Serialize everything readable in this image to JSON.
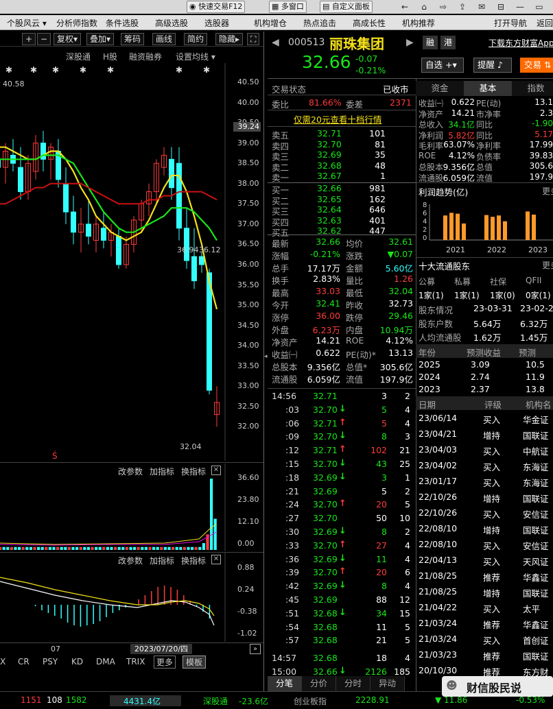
{
  "topbar": {
    "quick_trade": "快速交易F12",
    "multi_window": "多窗口",
    "custom_panel": "自定义面板"
  },
  "menu": [
    "个股风云",
    "分析师指数",
    "条件选股",
    "高级选股",
    "选股器",
    "机构增仓",
    "热点追击",
    "高成长性",
    "机构推荐",
    "打开导航",
    "返回"
  ],
  "chart_toolbar": {
    "restore": "复权",
    "overlay": "叠加",
    "chips": "筹码",
    "draw": "画线",
    "simple": "简约",
    "hide": "隐藏"
  },
  "chart_tabs": [
    "深股通",
    "H股",
    "融资融券",
    "设置均线"
  ],
  "price_axis": [
    "40.50",
    "40.00",
    "39.50",
    "39.00",
    "38.50",
    "38.00",
    "37.50",
    "37.00",
    "36.50",
    "36.00",
    "35.50",
    "35.00",
    "34.50",
    "34.00",
    "33.50",
    "33.00",
    "32.50",
    "32.00"
  ],
  "price_labels": {
    "high": "40.58",
    "current_tag": "39.24",
    "low": "32.04",
    "mid": "36.94",
    "mid2": "36.12"
  },
  "vol_panel": {
    "btns": [
      "改参数",
      "加指标",
      "换指标"
    ],
    "axis": [
      "36.60",
      "23.80",
      "12.10",
      "0.00"
    ]
  },
  "macd_panel": {
    "btns": [
      "改参数",
      "加指标",
      "换指标"
    ],
    "axis": [
      "0.88",
      "0.24",
      "-0.38",
      "-1.02"
    ]
  },
  "date_axis": {
    "label": "07",
    "cursor": "2023/07/20/四"
  },
  "indicators": [
    "X",
    "CR",
    "PSY",
    "KD",
    "DMA",
    "TRIX",
    "更多",
    "模板"
  ],
  "stock": {
    "code": "000513",
    "name": "丽珠集团",
    "price": "32.66",
    "change": "-0.07",
    "pct": "-0.21%",
    "btn_r": "融",
    "btn_g": "港",
    "download": "下载东方财富App",
    "add": "自选",
    "alert": "提醒",
    "trade": "交易"
  },
  "order": {
    "status_label": "交易状态",
    "status": "已收市",
    "webi_label": "委比",
    "webi": "81.66%",
    "weicha_label": "委差",
    "weicha": "2371",
    "promo": "仅需20元查看十档行情",
    "sells": [
      {
        "l": "卖五",
        "p": "32.71",
        "v": "101"
      },
      {
        "l": "卖四",
        "p": "32.70",
        "v": "81"
      },
      {
        "l": "卖三",
        "p": "32.69",
        "v": "35"
      },
      {
        "l": "卖二",
        "p": "32.68",
        "v": "48"
      },
      {
        "l": "卖一",
        "p": "32.67",
        "v": "1"
      }
    ],
    "buys": [
      {
        "l": "买一",
        "p": "32.66",
        "v": "981"
      },
      {
        "l": "买二",
        "p": "32.65",
        "v": "162"
      },
      {
        "l": "买三",
        "p": "32.64",
        "v": "646"
      },
      {
        "l": "买四",
        "p": "32.63",
        "v": "401"
      },
      {
        "l": "买五",
        "p": "32.62",
        "v": "447"
      }
    ]
  },
  "quote": [
    [
      "最新",
      "32.66",
      "均价",
      "32.61"
    ],
    [
      "涨幅",
      "-0.21%",
      "涨跌",
      "▼0.07"
    ],
    [
      "总手",
      "17.17万",
      "金额",
      "5.60亿"
    ],
    [
      "换手",
      "2.83%",
      "量比",
      "1.26"
    ],
    [
      "最高",
      "33.03",
      "最低",
      "32.04"
    ],
    [
      "今开",
      "32.41",
      "昨收",
      "32.73"
    ],
    [
      "涨停",
      "36.00",
      "跌停",
      "29.46"
    ],
    [
      "外盘",
      "6.23万",
      "内盘",
      "10.94万"
    ],
    [
      "净资产",
      "14.21",
      "ROE",
      "4.12%"
    ],
    [
      "收益㈠",
      "0.622",
      "PE(动)*",
      "13.13"
    ],
    [
      "总股本",
      "9.356亿",
      "总值*",
      "305.6亿"
    ],
    [
      "流通股",
      "6.059亿",
      "流值",
      "197.9亿"
    ]
  ],
  "ticks": [
    {
      "t": "14:56",
      "p": "32.71",
      "a": "",
      "v": "3",
      "n": "2"
    },
    {
      "t": ":03",
      "p": "32.70",
      "a": "↓",
      "v": "5",
      "n": "4"
    },
    {
      "t": ":06",
      "p": "32.71",
      "a": "↑",
      "v": "5",
      "n": "4"
    },
    {
      "t": ":09",
      "p": "32.70",
      "a": "↓",
      "v": "8",
      "n": "3"
    },
    {
      "t": ":12",
      "p": "32.71",
      "a": "↑",
      "v": "102",
      "n": "21"
    },
    {
      "t": ":15",
      "p": "32.70",
      "a": "↓",
      "v": "43",
      "n": "25"
    },
    {
      "t": ":18",
      "p": "32.69",
      "a": "↓",
      "v": "3",
      "n": "1"
    },
    {
      "t": ":21",
      "p": "32.69",
      "a": "",
      "v": "5",
      "n": "2"
    },
    {
      "t": ":24",
      "p": "32.70",
      "a": "↑",
      "v": "20",
      "n": "5"
    },
    {
      "t": ":27",
      "p": "32.70",
      "a": "",
      "v": "50",
      "n": "10"
    },
    {
      "t": ":30",
      "p": "32.69",
      "a": "↓",
      "v": "8",
      "n": "2"
    },
    {
      "t": ":33",
      "p": "32.70",
      "a": "↑",
      "v": "27",
      "n": "4"
    },
    {
      "t": ":36",
      "p": "32.69",
      "a": "↓",
      "v": "11",
      "n": "4"
    },
    {
      "t": ":39",
      "p": "32.70",
      "a": "↑",
      "v": "20",
      "n": "6"
    },
    {
      "t": ":42",
      "p": "32.69",
      "a": "↓",
      "v": "8",
      "n": "4"
    },
    {
      "t": ":45",
      "p": "32.69",
      "a": "",
      "v": "88",
      "n": "12"
    },
    {
      "t": ":51",
      "p": "32.68",
      "a": "↓",
      "v": "34",
      "n": "15"
    },
    {
      "t": ":54",
      "p": "32.68",
      "a": "",
      "v": "11",
      "n": "5"
    },
    {
      "t": ":57",
      "p": "32.68",
      "a": "",
      "v": "21",
      "n": "5"
    },
    {
      "t": "14:57",
      "p": "32.68",
      "a": "",
      "v": "18",
      "n": "4"
    },
    {
      "t": "15:00",
      "p": "32.66",
      "a": "↓",
      "v": "2126",
      "n": "185"
    }
  ],
  "tick_tabs": [
    "分笔",
    "分价",
    "分时",
    "异动"
  ],
  "right_tabs": [
    "资金",
    "基本",
    "指数"
  ],
  "fund": [
    [
      "收益㈠",
      "0.622",
      "PE(动)",
      "13.1"
    ],
    [
      "净资产",
      "14.21",
      "市净率",
      "2.3"
    ],
    [
      "总收入",
      "34.1亿",
      "同比",
      "-1.90"
    ],
    [
      "净利润",
      "5.82亿",
      "同比",
      "5.17"
    ],
    [
      "毛利率",
      "63.07%",
      "净利率",
      "17.99"
    ],
    [
      "ROE",
      "4.12%",
      "负债率",
      "39.83"
    ],
    [
      "总股本",
      "9.356亿",
      "总值",
      "305.6"
    ],
    [
      "流通股",
      "6.059亿",
      "流值",
      "197.9"
    ]
  ],
  "profit": {
    "title": "利润趋势(亿)",
    "more": "更多",
    "years": [
      "2021",
      "2022",
      "2023"
    ],
    "axis": [
      "8",
      "6",
      "4",
      "2",
      "0"
    ],
    "chart_data": {
      "type": "bar",
      "categories": [
        "2021Q1",
        "2021Q2",
        "2021Q3",
        "2021Q4",
        "2022Q1",
        "2022Q2",
        "2022Q3",
        "2022Q4",
        "2023Q1",
        "2023Q2"
      ],
      "values": [
        5.5,
        6.1,
        5.9,
        3.7,
        5.6,
        5.2,
        5.5,
        4.2,
        6.4,
        5.7
      ],
      "ylim": [
        0,
        8
      ]
    }
  },
  "holders": {
    "title": "十大流通股东",
    "more": "更多",
    "cols": [
      "公募",
      "私募",
      "社保",
      "QFII"
    ],
    "vals": [
      "1家(1)",
      "1家(1)",
      "1家(0)",
      "0家(1)"
    ],
    "rows": [
      [
        "股东情况",
        "23-03-31",
        "23-02-2"
      ],
      [
        "股东户数",
        "5.64万",
        "6.32万"
      ],
      [
        "人均流通股",
        "1.62万",
        "1.45万"
      ]
    ]
  },
  "forecast": {
    "cols": [
      "年份",
      "预测收益",
      "预测"
    ],
    "rows": [
      [
        "2025",
        "3.09",
        "10.5"
      ],
      [
        "2024",
        "2.74",
        "11.9"
      ],
      [
        "2023",
        "2.37",
        "13.8"
      ]
    ]
  },
  "ratings": {
    "cols": [
      "日期",
      "评级",
      "机构名"
    ],
    "rows": [
      [
        "23/06/14",
        "买入",
        "华金证"
      ],
      [
        "23/04/21",
        "增持",
        "国联证"
      ],
      [
        "23/04/03",
        "买入",
        "中航证"
      ],
      [
        "23/04/02",
        "买入",
        "东海证"
      ],
      [
        "23/01/17",
        "买入",
        "东海证"
      ],
      [
        "22/10/26",
        "增持",
        "国联证"
      ],
      [
        "22/10/26",
        "买入",
        "安信证"
      ],
      [
        "22/08/10",
        "增持",
        "国联证"
      ],
      [
        "22/08/10",
        "买入",
        "安信证"
      ],
      [
        "22/04/13",
        "买入",
        "天风证"
      ],
      [
        "21/08/25",
        "推荐",
        "华鑫证"
      ],
      [
        "21/08/25",
        "增持",
        "国联证"
      ],
      [
        "21/04/22",
        "买入",
        "太平"
      ],
      [
        "21/03/24",
        "推荐",
        "华鑫证"
      ],
      [
        "21/03/24",
        "买入",
        "首创证"
      ],
      [
        "21/03/23",
        "推荐",
        "国联证"
      ],
      [
        "20/10/30",
        "推荐",
        "东方财"
      ]
    ]
  },
  "status": {
    "v1": "1151",
    "v2": "108",
    "v3": "1582",
    "amount": "4431.4亿",
    "sgt": "深股通",
    "sgt_v": "-23.6亿",
    "cyb": "创业板指",
    "cyb_p": "2228.91",
    "cyb_c": "▼ 11.86",
    "cyb_pct": "-0.53%",
    "watermark": "财信股民说"
  },
  "colors": {
    "up": "#ff3b3b",
    "down": "#19e619",
    "flat": "#ffffff",
    "cyan": "#33ffff",
    "yellow": "#f5e11a"
  }
}
